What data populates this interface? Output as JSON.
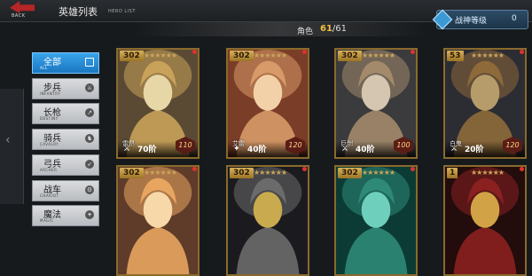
{
  "header": {
    "back_label": "BACK",
    "title": "英雄列表",
    "title_sub": "HERO LIST",
    "rank_button": {
      "label": "战神等级",
      "value": "0",
      "icon": "diamond-icon"
    }
  },
  "count": {
    "label": "角色",
    "current": "61",
    "total": "/61"
  },
  "filters": [
    {
      "label": "全部",
      "sub": "ALL",
      "icon": "square-icon",
      "active": true
    },
    {
      "label": "步兵",
      "sub": "INFANTRY",
      "icon": "sword-icon"
    },
    {
      "label": "长枪",
      "sub": "DESTINY",
      "icon": "spear-icon"
    },
    {
      "label": "骑兵",
      "sub": "CAVALRY",
      "icon": "horse-icon"
    },
    {
      "label": "弓兵",
      "sub": "ARCHER",
      "icon": "bow-icon"
    },
    {
      "label": "战车",
      "sub": "CHARIOT",
      "icon": "chariot-icon"
    },
    {
      "label": "魔法",
      "sub": "MAGIC",
      "icon": "magic-icon"
    }
  ],
  "heroes": [
    {
      "level": "302",
      "name": "雷昂",
      "rank": "70阶",
      "power": "110",
      "colors": [
        "#c9a25a",
        "#5a4a34",
        "#e7d7a6"
      ]
    },
    {
      "level": "302",
      "name": "艾雷",
      "rank": "40阶",
      "power": "120",
      "colors": [
        "#d79a68",
        "#7a3d27",
        "#f3d1a8"
      ]
    },
    {
      "level": "302",
      "name": "巨剑",
      "rank": "40阶",
      "power": "100",
      "colors": [
        "#a38a6b",
        "#3b3a3d",
        "#d4c6b1"
      ]
    },
    {
      "level": "53",
      "name": "白鬼",
      "rank": "20阶",
      "power": "120",
      "colors": [
        "#8e6a3a",
        "#2c2c33",
        "#b59c6a"
      ]
    },
    {
      "level": "302",
      "name": "",
      "rank": "",
      "power": "",
      "colors": [
        "#e7a55f",
        "#5f3b2a",
        "#f7d8a8"
      ]
    },
    {
      "level": "302",
      "name": "",
      "rank": "",
      "power": "",
      "colors": [
        "#6b6b6b",
        "#1b1b1f",
        "#c9aa4e"
      ]
    },
    {
      "level": "302",
      "name": "",
      "rank": "",
      "power": "",
      "colors": [
        "#2e8a76",
        "#0c3b35",
        "#6ed0bc"
      ]
    },
    {
      "level": "1",
      "name": "",
      "rank": "",
      "power": "",
      "colors": [
        "#8b2020",
        "#220c0c",
        "#d1a346"
      ]
    }
  ]
}
